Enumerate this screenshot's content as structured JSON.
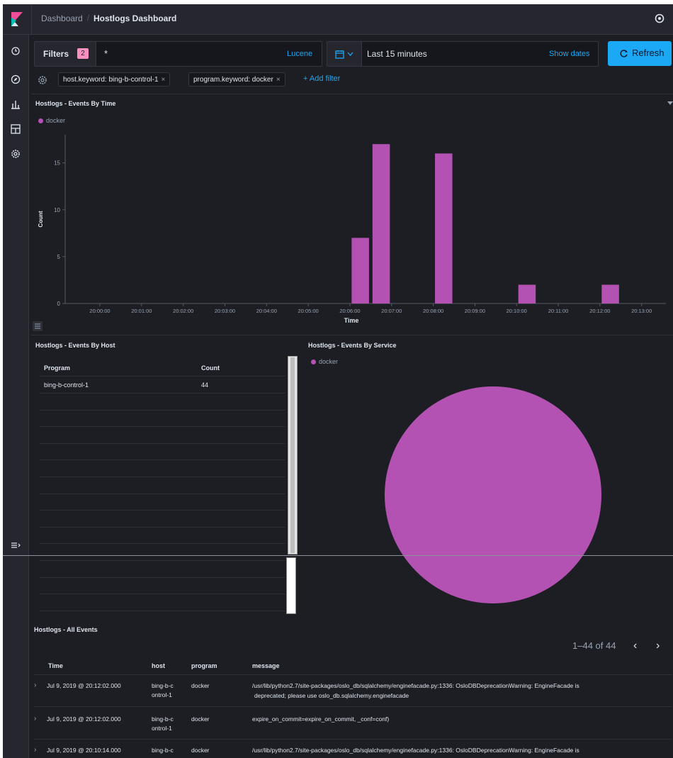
{
  "header": {
    "breadcrumb_parent": "Dashboard",
    "breadcrumb_current": "Hostlogs Dashboard"
  },
  "nav": {
    "icons": [
      "clock-icon",
      "compass-icon",
      "visualize-icon",
      "dashboard-icon",
      "settings-icon",
      "dock-icon"
    ]
  },
  "query": {
    "filters_label": "Filters",
    "filters_count": "2",
    "query_value": "*",
    "language": "Lucene",
    "time_range": "Last 15 minutes",
    "show_dates": "Show dates",
    "refresh": "Refresh"
  },
  "filters": {
    "pills": [
      "host.keyword: bing-b-control-1",
      "program.keyword: docker"
    ],
    "add_filter": "+ Add filter"
  },
  "events_by_time": {
    "title": "Hostlogs - Events By Time",
    "legend": "docker"
  },
  "chart_data": {
    "type": "bar",
    "title": "Hostlogs - Events By Time",
    "xlabel": "Time",
    "ylabel": "Count",
    "x_ticks": [
      "20:00:00",
      "20:01:00",
      "20:02:00",
      "20:03:00",
      "20:04:00",
      "20:05:00",
      "20:06:00",
      "20:07:00",
      "20:08:00",
      "20:09:00",
      "20:10:00",
      "20:11:00",
      "20:12:00",
      "20:13:00"
    ],
    "y_ticks": [
      0,
      5,
      10,
      15
    ],
    "ylim": [
      0,
      18
    ],
    "series": [
      {
        "name": "docker",
        "color": "#b352b3",
        "points": [
          {
            "time": "20:06:15",
            "value": 7
          },
          {
            "time": "20:06:45",
            "value": 17
          },
          {
            "time": "20:08:15",
            "value": 16
          },
          {
            "time": "20:10:15",
            "value": 2
          },
          {
            "time": "20:12:15",
            "value": 2
          }
        ]
      }
    ],
    "bar_width_seconds": 25,
    "x_range": [
      "19:59:10",
      "20:13:35"
    ],
    "grid": false,
    "legend_position": "top-left"
  },
  "events_by_host": {
    "title": "Hostlogs - Events By Host",
    "columns": [
      "Program",
      "Count"
    ],
    "rows": [
      [
        "bing-b-control-1",
        "44"
      ]
    ]
  },
  "events_by_service": {
    "title": "Hostlogs - Events By Service",
    "legend": "docker",
    "pie": [
      {
        "label": "docker",
        "value": 44,
        "color": "#b352b3"
      }
    ]
  },
  "all_events": {
    "title": "Hostlogs - All Events",
    "pager": "1–44 of 44",
    "columns": [
      "Time",
      "host",
      "program",
      "message"
    ],
    "rows": [
      {
        "time": "Jul 9, 2019 @ 20:12:02.000",
        "host_line1": "bing-b-c",
        "host_line2": "ontrol-1",
        "program": "docker",
        "message_line1": "/usr/lib/python2.7/site-packages/oslo_db/sqlalchemy/enginefacade.py:1336: OsloDBDeprecationWarning: EngineFacade is",
        "message_line2": "deprecated; please use oslo_db.sqlalchemy.enginefacade"
      },
      {
        "time": "Jul 9, 2019 @ 20:12:02.000",
        "host_line1": "bing-b-c",
        "host_line2": "ontrol-1",
        "program": "docker",
        "message_line1": "expire_on_commit=expire_on_commit, _conf=conf)",
        "message_line2": ""
      },
      {
        "time": "Jul 9, 2019 @ 20:10:14.000",
        "host_line1": "bing-b-c",
        "host_line2": "",
        "program": "docker",
        "message_line1": "/usr/lib/python2.7/site-packages/oslo_db/sqlalchemy/enginefacade.py:1336: OsloDBDeprecationWarning: EngineFacade is",
        "message_line2": ""
      }
    ]
  },
  "colors": {
    "background": "#1d1e24",
    "accent": "#1ba9f5",
    "series": "#b352b3",
    "badge": "#f990c0"
  }
}
